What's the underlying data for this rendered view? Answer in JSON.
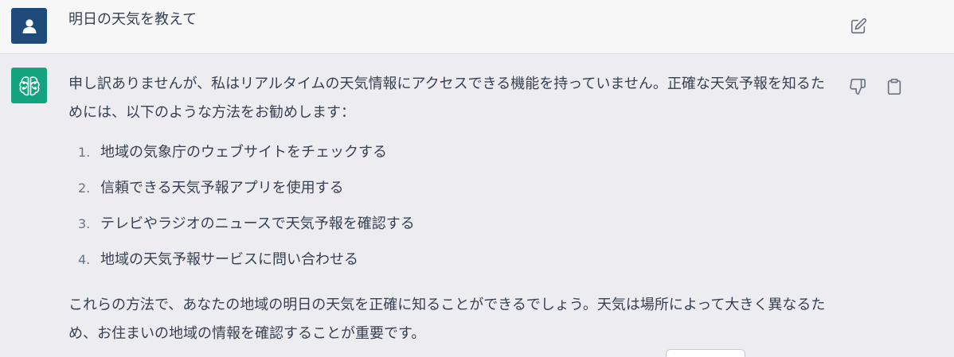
{
  "user_message": {
    "text": "明日の天気を教えて",
    "avatar_icon": "user-icon",
    "avatar_color": "#1e4b7a"
  },
  "assistant_message": {
    "avatar_icon": "openai-logo-icon",
    "avatar_color": "#14a37f",
    "intro": "申し訳ありませんが、私はリアルタイムの天気情報にアクセスできる機能を持っていません。正確な天気予報を知るためには、以下のような方法をお勧めします：",
    "list": [
      {
        "num": "1.",
        "text": "地域の気象庁のウェブサイトをチェックする"
      },
      {
        "num": "2.",
        "text": "信頼できる天気予報アプリを使用する"
      },
      {
        "num": "3.",
        "text": "テレビやラジオのニュースで天気予報を確認する"
      },
      {
        "num": "4.",
        "text": "地域の天気予報サービスに問い合わせる"
      }
    ],
    "outro": "これらの方法で、あなたの地域の明日の天気を正確に知ることができるでしょう。天気は場所によって大きく異なるため、お住まいの地域の情報を確認することが重要です。"
  },
  "icons": {
    "edit": "edit-icon",
    "thumbs_down": "thumbs-down-icon",
    "copy": "clipboard-icon"
  }
}
